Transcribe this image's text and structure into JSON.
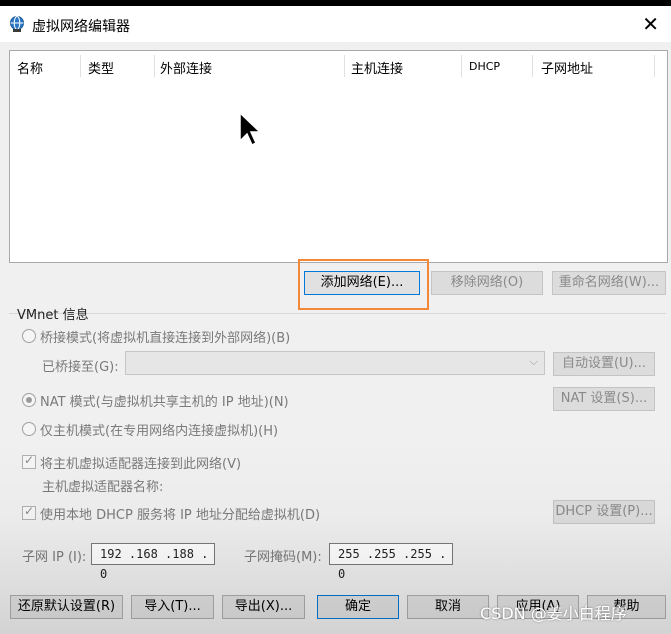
{
  "window": {
    "title": "虚拟网络编辑器",
    "close_glyph": "✕"
  },
  "network_list": {
    "columns": [
      "名称",
      "类型",
      "外部连接",
      "主机连接",
      "DHCP",
      "子网地址"
    ],
    "rows": []
  },
  "list_buttons": {
    "add": "添加网络(E)...",
    "remove": "移除网络(O)",
    "rename": "重命名网络(W)..."
  },
  "vmnet_info": {
    "group_title": "VMnet 信息",
    "bridged_mode": "桥接模式(将虚拟机直接连接到外部网络)(B)",
    "bridged_to_label": "已桥接至(G):",
    "bridged_to_value": "",
    "auto_settings": "自动设置(U)...",
    "nat_mode": "NAT 模式(与虚拟机共享主机的 IP 地址)(N)",
    "nat_settings": "NAT 设置(S)...",
    "host_only_mode": "仅主机模式(在专用网络内连接虚拟机)(H)",
    "selected_mode": "nat",
    "connect_adapter": "将主机虚拟适配器连接到此网络(V)",
    "connect_adapter_checked": true,
    "adapter_name_label": "主机虚拟适配器名称:",
    "use_dhcp": "使用本地 DHCP 服务将 IP 地址分配给虚拟机(D)",
    "use_dhcp_checked": true,
    "dhcp_settings": "DHCP 设置(P)...",
    "subnet_ip_label": "子网 IP (I):",
    "subnet_ip_value": "192 .168 .188 . 0",
    "subnet_mask_label": "子网掩码(M):",
    "subnet_mask_value": "255 .255 .255 . 0"
  },
  "footer": {
    "restore_defaults": "还原默认设置(R)",
    "import": "导入(T)...",
    "export": "导出(X)...",
    "ok": "确定",
    "cancel": "取消",
    "apply": "应用(A)",
    "help": "帮助"
  },
  "watermark": "CSDN @姜小白程序",
  "colors": {
    "highlight": "#f08a3a",
    "focus": "#0078d7",
    "window_bg": "#f0f0f0"
  },
  "icons": [
    "network-globe-icon",
    "close-icon",
    "mouse-cursor-icon",
    "chevron-down-icon"
  ]
}
